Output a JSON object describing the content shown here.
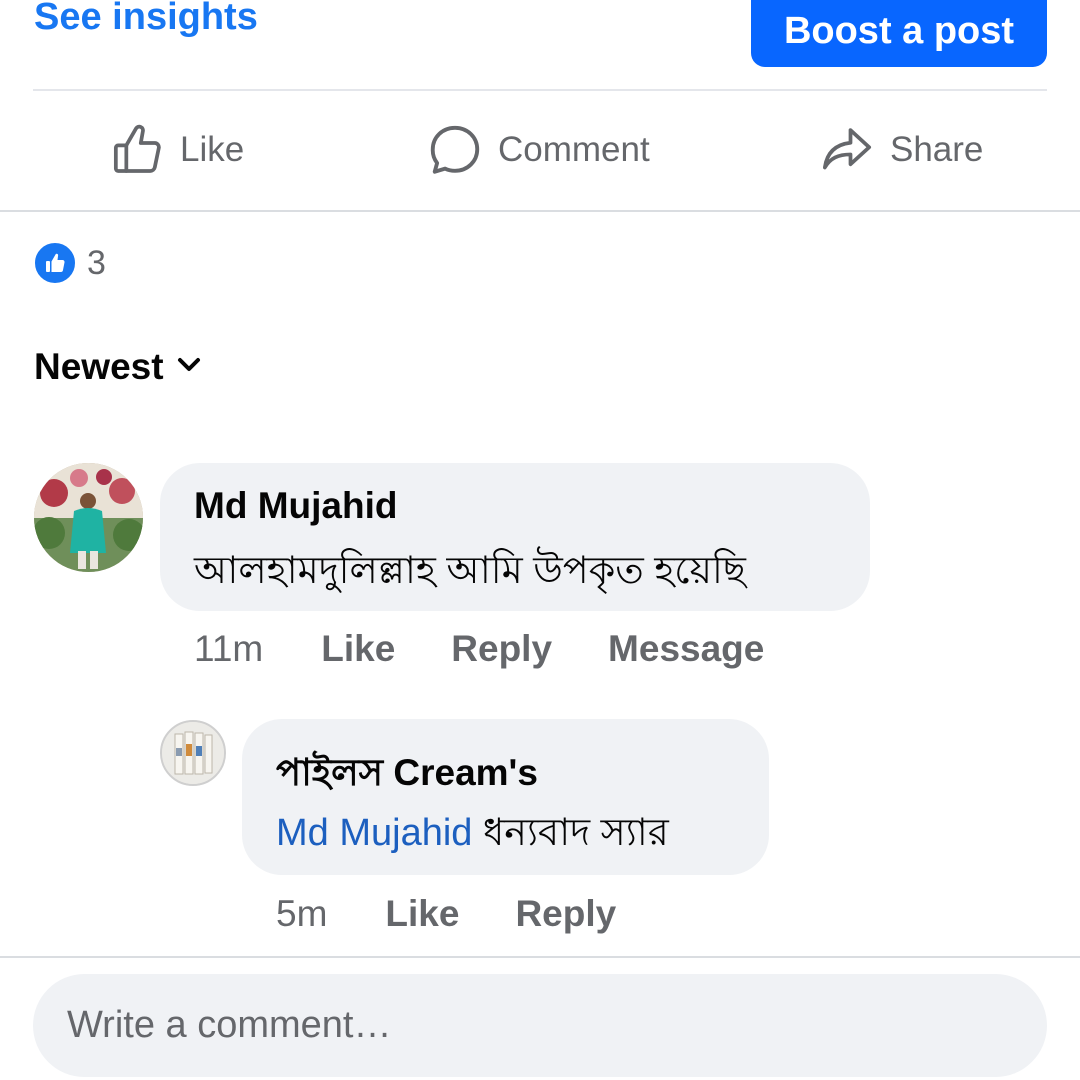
{
  "header": {
    "see_insights": "See insights",
    "boost_post": "Boost a post"
  },
  "actions": {
    "like": "Like",
    "comment": "Comment",
    "share": "Share"
  },
  "reactions": {
    "icon": "thumbs-up-icon",
    "count": "3"
  },
  "sort": {
    "label": "Newest",
    "icon": "chevron-down-icon"
  },
  "comments": [
    {
      "author": "Md Mujahid",
      "text": "আলহামদুলিল্লাহ আমি উপকৃত হয়েছি",
      "time": "11m",
      "actions": [
        "Like",
        "Reply",
        "Message"
      ],
      "reply": {
        "author": "পাইলস Cream's",
        "mention": "Md Mujahid",
        "text": "ধন্যবাদ স্যার",
        "time": "5m",
        "actions": [
          "Like",
          "Reply"
        ]
      }
    }
  ],
  "composer": {
    "placeholder": "Write a comment…"
  },
  "colors": {
    "accent": "#1877f2",
    "boost": "#0866ff",
    "secondary_text": "#65676b",
    "bubble": "#f0f2f5",
    "mention": "#1c5fbf"
  }
}
